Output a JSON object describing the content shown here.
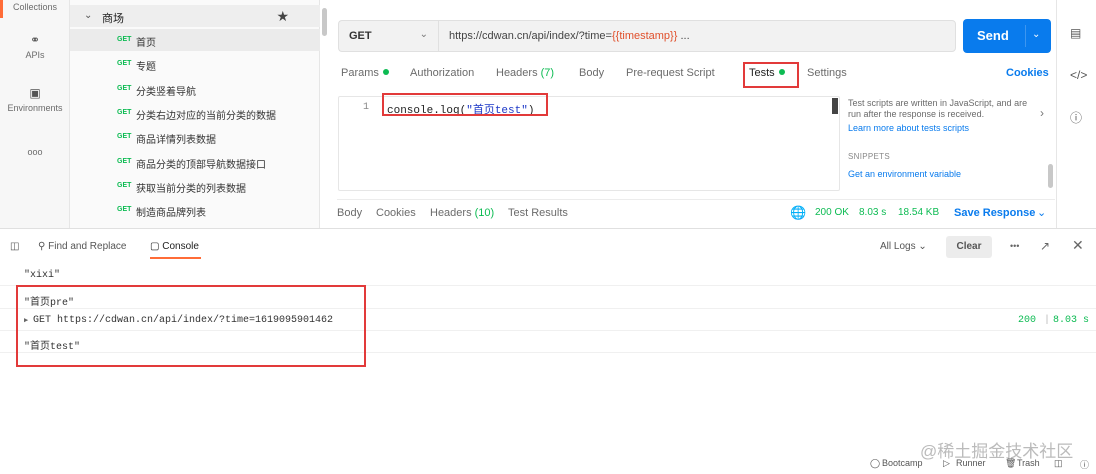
{
  "rail": {
    "items": [
      {
        "label": "Collections",
        "icon": "collections-icon"
      },
      {
        "label": "APIs",
        "icon": "apis-icon"
      },
      {
        "label": "Environments",
        "icon": "environments-icon"
      },
      {
        "label": "ooo",
        "icon": "more-icon"
      }
    ]
  },
  "tree": {
    "folder": "商场",
    "requests": [
      {
        "method": "GET",
        "title": "首页"
      },
      {
        "method": "GET",
        "title": "专题"
      },
      {
        "method": "GET",
        "title": "分类竖着导航"
      },
      {
        "method": "GET",
        "title": "分类右边对应的当前分类的数据"
      },
      {
        "method": "GET",
        "title": "商品详情列表数据"
      },
      {
        "method": "GET",
        "title": "商品分类的顶部导航数据接口"
      },
      {
        "method": "GET",
        "title": "获取当前分类的列表数据"
      },
      {
        "method": "GET",
        "title": "制造商品牌列表"
      }
    ]
  },
  "request": {
    "method": "GET",
    "url_prefix": "https://cdwan.cn/api/index/?time=",
    "url_var": "{{timestamp}}",
    "url_suffix": " ...",
    "send": "Send"
  },
  "tabs": {
    "params": "Params",
    "authorization": "Authorization",
    "headers": "Headers",
    "headers_count": "(7)",
    "body": "Body",
    "prerequest": "Pre-request Script",
    "tests": "Tests",
    "settings": "Settings",
    "cookies": "Cookies"
  },
  "editor": {
    "line": "1",
    "code_pre": "console.log(",
    "code_str": "\"首页test\"",
    "code_post": ")"
  },
  "snippets": {
    "info": "Test scripts are written in JavaScript, and are run after the response is received.",
    "learn": "Learn more about tests scripts",
    "heading": "SNIPPETS",
    "first": "Get an environment variable"
  },
  "response": {
    "body": "Body",
    "cookies": "Cookies",
    "headers": "Headers",
    "headers_count": "(10)",
    "test_results": "Test Results",
    "status": "200 OK",
    "time": "8.03 s",
    "size": "18.54 KB",
    "save": "Save Response"
  },
  "console": {
    "find_replace": "Find and Replace",
    "console": "Console",
    "all_logs": "All Logs",
    "clear": "Clear",
    "rows": [
      "\"xixi\"",
      "\"首页pre\"",
      "GET https://cdwan.cn/api/index/?time=1619095901462",
      "\"首页test\""
    ],
    "request_status": "200",
    "request_time": "8.03 s"
  },
  "watermark": "@稀土掘金技术社区",
  "footer": {
    "bootcamp": "Bootcamp",
    "runner": "Runner",
    "trash": "Trash"
  },
  "colors": {
    "accent": "#ff6c37",
    "primary": "#097bed",
    "success": "#0cbb52",
    "highlight": "#e23a3a"
  }
}
